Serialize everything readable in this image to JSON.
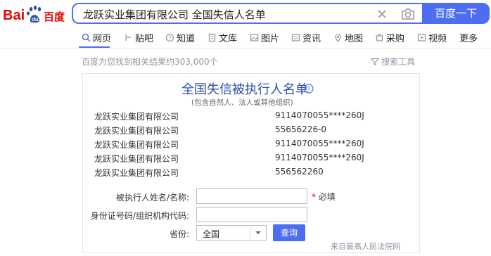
{
  "brand": {
    "logo_text": "Bai百度"
  },
  "search": {
    "query": "龙跃实业集团有限公司  全国失信人名单",
    "button_label": "百度一下"
  },
  "tabs": [
    {
      "label": "网页",
      "icon": "search-icon",
      "active": true
    },
    {
      "label": "贴吧",
      "icon": "tieba-icon"
    },
    {
      "label": "知道",
      "icon": "zhidao-icon"
    },
    {
      "label": "文库",
      "icon": "wenku-icon"
    },
    {
      "label": "图片",
      "icon": "image-icon"
    },
    {
      "label": "资讯",
      "icon": "news-icon"
    },
    {
      "label": "地图",
      "icon": "map-icon"
    },
    {
      "label": "采购",
      "icon": "purchase-icon"
    },
    {
      "label": "视频",
      "icon": "video-icon"
    },
    {
      "label": "更多"
    }
  ],
  "results": {
    "count_text": "百度为您找到相关结果约303,000个",
    "tools_label": "搜索工具"
  },
  "card": {
    "title": "全国失信被执行人名单",
    "subtitle": "(包含自然人、法人或其他组织)",
    "rows": [
      {
        "name": "龙跃实业集团有限公司",
        "code": "9114070055****260J"
      },
      {
        "name": "龙跃实业集团有限公司",
        "code": "55656226-0"
      },
      {
        "name": "龙跃实业集团有限公司",
        "code": "9114070055****260J"
      },
      {
        "name": "龙跃实业集团有限公司",
        "code": "9114070055****260J"
      },
      {
        "name": "龙跃实业集团有限公司",
        "code": "556562260"
      }
    ],
    "form": {
      "name_label": "被执行人姓名/名称:",
      "required_mark": "*",
      "required_text": "必填",
      "id_label": "身份证号码/组织机构代码:",
      "province_label": "省份:",
      "province_value": "全国",
      "query_button": "查询"
    },
    "source": "来自最高人民法院网"
  },
  "colors": {
    "accent": "#4e6ef2",
    "title": "#2d4ea8",
    "logo_red": "#e10601"
  }
}
